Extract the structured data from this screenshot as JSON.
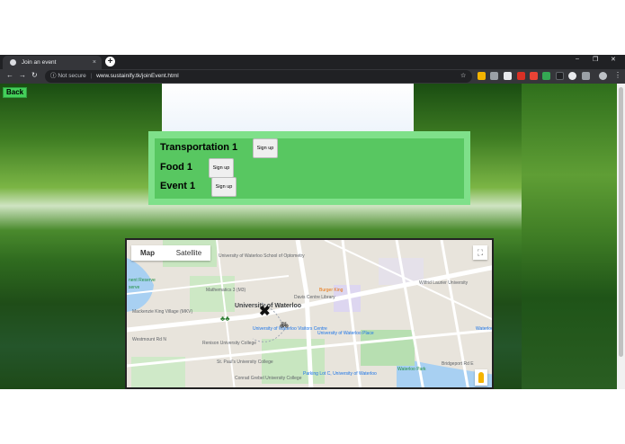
{
  "browser": {
    "tab_title": "Join an event",
    "tab_close_icon": "×",
    "new_tab_icon": "+",
    "security_label": "Not secure",
    "url": "www.sustainify.tk/joinEvent.html",
    "window_controls": [
      "–",
      "❐",
      "✕"
    ]
  },
  "page": {
    "back_label": "Back",
    "events": [
      {
        "label": "Transportation 1",
        "signup_label": "Sign up"
      },
      {
        "label": "Food 1",
        "signup_label": "Sign up"
      },
      {
        "label": "Event 1",
        "signup_label": "Sign up"
      }
    ]
  },
  "map": {
    "type_map": "Map",
    "type_satellite": "Satellite",
    "labels": {
      "uw_optometry": "University of Waterloo School of Optometry",
      "math3": "Mathematics 3 (M3)",
      "davis": "Davis Centre Library",
      "burger_king": "Burger King",
      "wilfrid": "Wilfrid Laurier University",
      "mackenzie": "Mackenzie King Village (MKV)",
      "uw_big": "University of Waterloo",
      "uw_visitors": "University of Waterloo Visitors Centre",
      "uw_place": "University of Waterloo Place",
      "renison": "Renison University College",
      "st_pauls": "St. Paul's University College",
      "conrad": "Conrad Grebel University College",
      "parking": "Parking Lot C, University of Waterloo",
      "waterloo_park": "Waterloo Park",
      "bridgeport": "Bridgeport Rd E",
      "westmount": "Westmount Rd N",
      "waterloo": "Waterloo",
      "serve": "serve",
      "nt_reserve": "nent Reserve"
    }
  },
  "colors": {
    "accent_panel": "#7fe08a",
    "accent_panel_inner": "#58c761",
    "back_button": "#44d05a"
  }
}
